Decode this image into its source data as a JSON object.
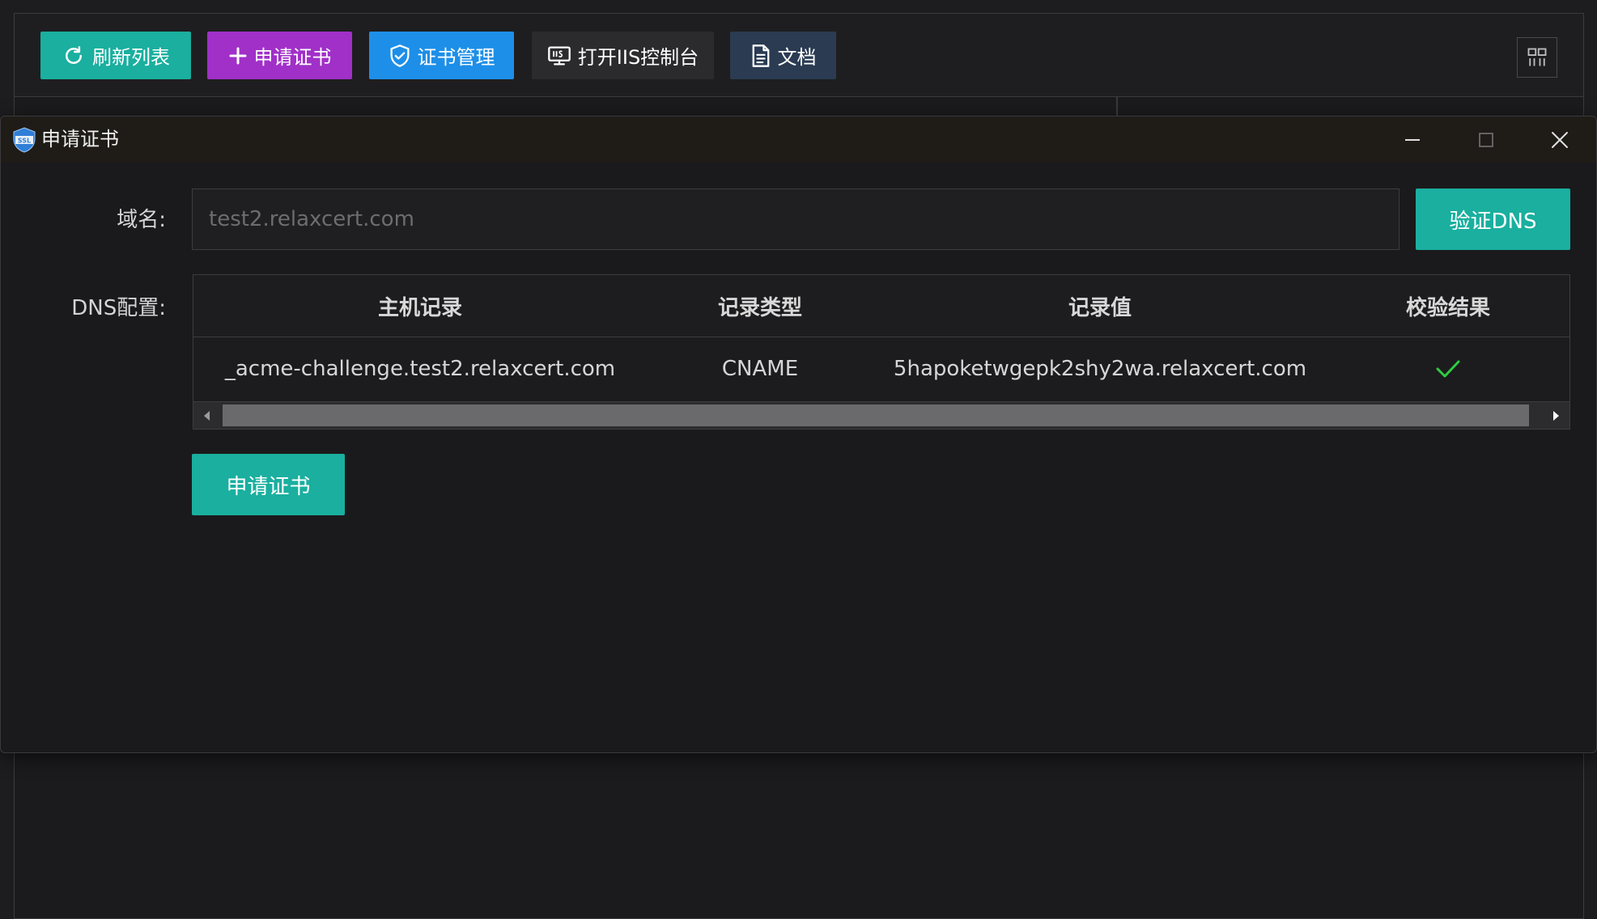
{
  "toolbar": {
    "refresh_label": "刷新列表",
    "apply_label": "申请证书",
    "certs_label": "证书管理",
    "iis_label": "打开IIS控制台",
    "docs_label": "文档"
  },
  "dialog": {
    "title": "申请证书",
    "icon_text": "SSL",
    "domain_label": "域名:",
    "domain_placeholder": "test2.relaxcert.com",
    "domain_value": "",
    "verify_button": "验证DNS",
    "dns_label": "DNS配置:",
    "apply_button": "申请证书"
  },
  "dns_table": {
    "columns": [
      "主机记录",
      "记录类型",
      "记录值",
      "校验结果"
    ],
    "rows": [
      {
        "host": "_acme-challenge.test2.relaxcert.com",
        "type": "CNAME",
        "value": "5hapoketwgepk2shy2wa.relaxcert.com",
        "status": "check-icon"
      }
    ]
  },
  "colors": {
    "accent_teal": "#1aaf9f",
    "accent_purple": "#a030c8",
    "accent_blue": "#1d8fe8",
    "success_green": "#2ecc40"
  }
}
